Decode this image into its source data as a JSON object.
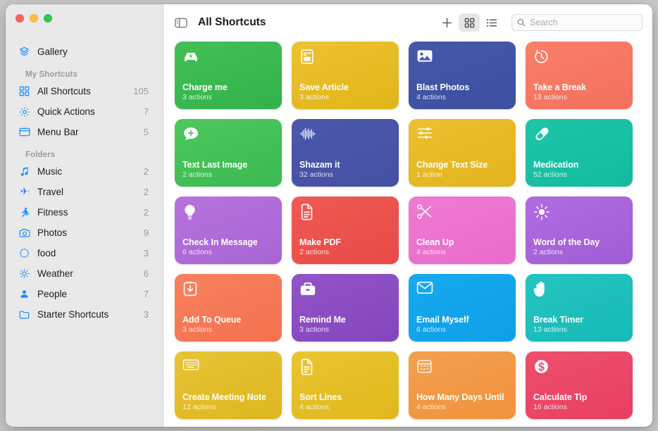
{
  "window": {
    "traffic_lights": [
      "close",
      "minimize",
      "zoom"
    ],
    "colors": {
      "close": "#f6655a",
      "minimize": "#fdbe42",
      "zoom": "#2fc94a",
      "accent": "#1a8cff"
    }
  },
  "toolbar": {
    "sidebar_toggle_icon": "sidebar-toggle-icon",
    "title": "All Shortcuts",
    "add_label": "+",
    "add_icon": "plus-icon",
    "grid_view_icon": "grid-view-icon",
    "list_view_icon": "list-view-icon",
    "active_view": "grid",
    "search": {
      "placeholder": "Search",
      "value": "",
      "icon": "search-icon"
    }
  },
  "sidebar": {
    "top_items": [
      {
        "label": "Gallery",
        "icon": "gallery-icon",
        "count": ""
      }
    ],
    "groups": [
      {
        "header": "My Shortcuts",
        "items": [
          {
            "label": "All Shortcuts",
            "icon": "grid-squares-icon",
            "count": "105",
            "selected": false
          },
          {
            "label": "Quick Actions",
            "icon": "gear-icon",
            "count": "7",
            "selected": false
          },
          {
            "label": "Menu Bar",
            "icon": "menubar-icon",
            "count": "5",
            "selected": false
          }
        ]
      },
      {
        "header": "Folders",
        "items": [
          {
            "label": "Music",
            "icon": "music-note-icon",
            "count": "2",
            "selected": false
          },
          {
            "label": "Travel",
            "icon": "airplane-icon",
            "count": "2",
            "selected": false
          },
          {
            "label": "Fitness",
            "icon": "runner-icon",
            "count": "2",
            "selected": false
          },
          {
            "label": "Photos",
            "icon": "camera-icon",
            "count": "9",
            "selected": false
          },
          {
            "label": "food",
            "icon": "dotted-circle-icon",
            "count": "3",
            "selected": false
          },
          {
            "label": "Weather",
            "icon": "sun-icon",
            "count": "6",
            "selected": false
          },
          {
            "label": "People",
            "icon": "person-icon",
            "count": "7",
            "selected": false
          },
          {
            "label": "Starter Shortcuts",
            "icon": "folder-icon",
            "count": "3",
            "selected": false
          }
        ]
      }
    ]
  },
  "shortcuts": [
    {
      "name": "Charge me",
      "actions": "3 actions",
      "icon": "car-bolt-icon",
      "c1": "#42c056",
      "c2": "#33b24b"
    },
    {
      "name": "Save Article",
      "actions": "3 actions",
      "icon": "article-icon",
      "c1": "#eec231",
      "c2": "#e0b518"
    },
    {
      "name": "Blast Photos",
      "actions": "4 actions",
      "icon": "photo-icon",
      "c1": "#4458aa",
      "c2": "#3d4f9e"
    },
    {
      "name": "Take a Break",
      "actions": "13 actions",
      "icon": "timer-icon",
      "c1": "#f98068",
      "c2": "#f4705c"
    },
    {
      "name": "Text Last Image",
      "actions": "2 actions",
      "icon": "message-plus-icon",
      "c1": "#4cc85f",
      "c2": "#3cb94f"
    },
    {
      "name": "Shazam it",
      "actions": "32 actions",
      "icon": "waveform-icon",
      "c1": "#4a58ad",
      "c2": "#4450a3"
    },
    {
      "name": "Change Text Size",
      "actions": "1 action",
      "icon": "sliders-icon",
      "c1": "#ecc02f",
      "c2": "#e2b41d"
    },
    {
      "name": "Medication",
      "actions": "52 actions",
      "icon": "pill-icon",
      "c1": "#1ec5a8",
      "c2": "#12bb9f"
    },
    {
      "name": "Check In Message",
      "actions": "6 actions",
      "icon": "lightbulb-icon",
      "c1": "#b673dd",
      "c2": "#a964d4"
    },
    {
      "name": "Make PDF",
      "actions": "2 actions",
      "icon": "document-icon",
      "c1": "#ef5a52",
      "c2": "#e84a47"
    },
    {
      "name": "Clean Up",
      "actions": "4 actions",
      "icon": "scissors-icon",
      "c1": "#ef7ad3",
      "c2": "#ea6bcb"
    },
    {
      "name": "Word of the Day",
      "actions": "2 actions",
      "icon": "sunshine-icon",
      "c1": "#b06ce0",
      "c2": "#a05dd6"
    },
    {
      "name": "Add To Queue",
      "actions": "3 actions",
      "icon": "download-box-icon",
      "c1": "#f9815f",
      "c2": "#f4714f"
    },
    {
      "name": "Remind Me",
      "actions": "3 actions",
      "icon": "briefcase-icon",
      "c1": "#9253c8",
      "c2": "#8546bd"
    },
    {
      "name": "Email Myself",
      "actions": "6 actions",
      "icon": "envelope-icon",
      "c1": "#17aaf0",
      "c2": "#0e9fe6"
    },
    {
      "name": "Break Timer",
      "actions": "13 actions",
      "icon": "hand-raised-icon",
      "c1": "#25c4c0",
      "c2": "#16bab8"
    },
    {
      "name": "Create Meeting Note",
      "actions": "12 actions",
      "icon": "keyboard-icon",
      "c1": "#e8c335",
      "c2": "#ddb71f"
    },
    {
      "name": "Sort Lines",
      "actions": "4 actions",
      "icon": "text-doc-icon",
      "c1": "#eac531",
      "c2": "#e0b81c"
    },
    {
      "name": "How Many Days Until",
      "actions": "4 actions",
      "icon": "calendar-icon",
      "c1": "#f4a04e",
      "c2": "#f0923c"
    },
    {
      "name": "Calculate Tip",
      "actions": "16 actions",
      "icon": "dollar-icon",
      "c1": "#ee4f6d",
      "c2": "#e83f61"
    }
  ]
}
